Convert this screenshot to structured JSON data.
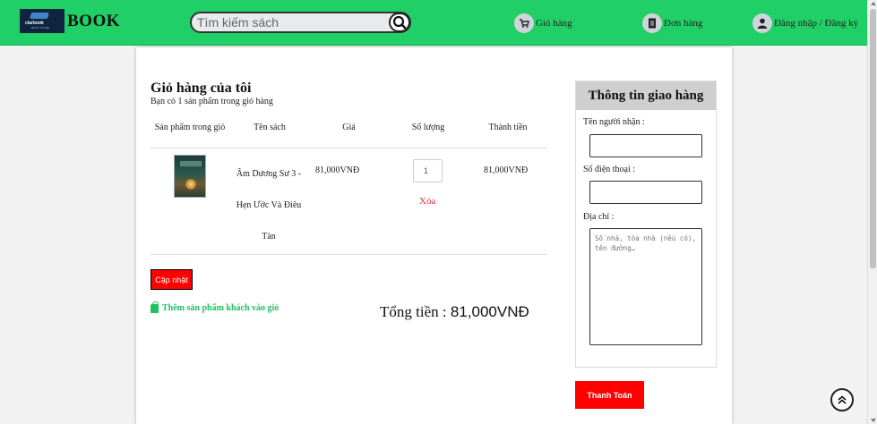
{
  "header": {
    "logo_text": "clarbook",
    "logo_sub": "BOOK STORE",
    "brand": "BOOK",
    "search_placeholder": "Tìm kiếm sách",
    "nav": {
      "cart_label": "Giỏ hàng",
      "orders_label": "Đơn hàng",
      "login_label": "Đăng nhập / Đăng ký"
    }
  },
  "cart": {
    "title": "Giỏ hàng của tôi",
    "subtitle": "Bạn có 1 sản phẩm trong giỏ hàng",
    "columns": [
      "Sản phẩm trong giỏ",
      "Tên sách",
      "Giá",
      "Số lượng",
      "Thành tiền"
    ],
    "items": [
      {
        "name": "Âm Dương Sư 3 - Hẹn Ước Và Điêu Tàn",
        "price": "81,000VNĐ",
        "quantity": "1",
        "remove_label": "Xóa",
        "line_total": "81,000VNĐ"
      }
    ],
    "update_label": "Cập nhật",
    "add_guest_label": "Thêm sản phẩm khách vào giỏ",
    "total_prefix": "Tổng tiền : ",
    "total_value": "81,000VNĐ"
  },
  "delivery": {
    "title": "Thông tin giao hàng",
    "recipient_label": "Tên người nhận :",
    "phone_label": "Số điện thoại :",
    "address_label": "Địa chỉ :",
    "address_placeholder": "Số nhà, tòa nhà (nếu có), tên đường…",
    "pay_label": "Thanh Toán"
  },
  "colors": {
    "header_green": "#20d066",
    "accent_red": "#ff0000",
    "link_green": "#20c060"
  }
}
